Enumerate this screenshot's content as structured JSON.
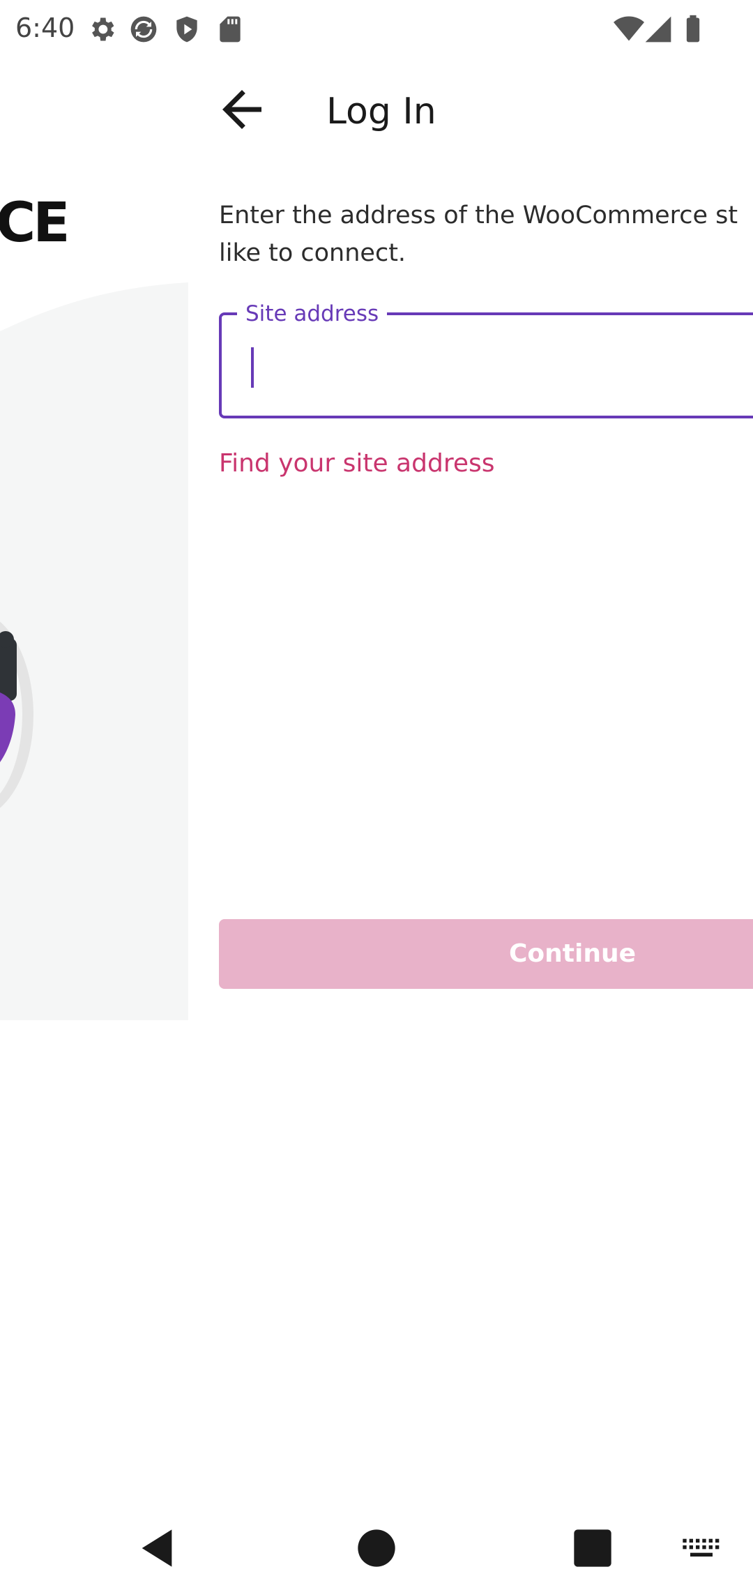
{
  "status_bar": {
    "time": "6:40",
    "left_icons": [
      "settings-icon",
      "sync-icon",
      "shield-icon",
      "sd-card-icon"
    ],
    "right_icons": [
      "wifi-icon",
      "cell-signal-icon",
      "battery-icon"
    ]
  },
  "toolbar": {
    "title": "Log In",
    "back_icon": "arrow-back-icon"
  },
  "illustration": {
    "logo_fragment": "CE"
  },
  "main": {
    "description": "Enter the address of the WooCommerce st\nlike to connect.",
    "site_field": {
      "label": "Site address",
      "value": "",
      "placeholder": ""
    },
    "find_link": "Find your site address",
    "continue_label": "Continue"
  },
  "nav_bar": {
    "icons": [
      "nav-back-icon",
      "nav-home-icon",
      "nav-recents-icon",
      "keyboard-icon"
    ]
  },
  "colors": {
    "accent": "#673ab7",
    "link": "#c9356e",
    "button_disabled": "#e8b2c9"
  }
}
